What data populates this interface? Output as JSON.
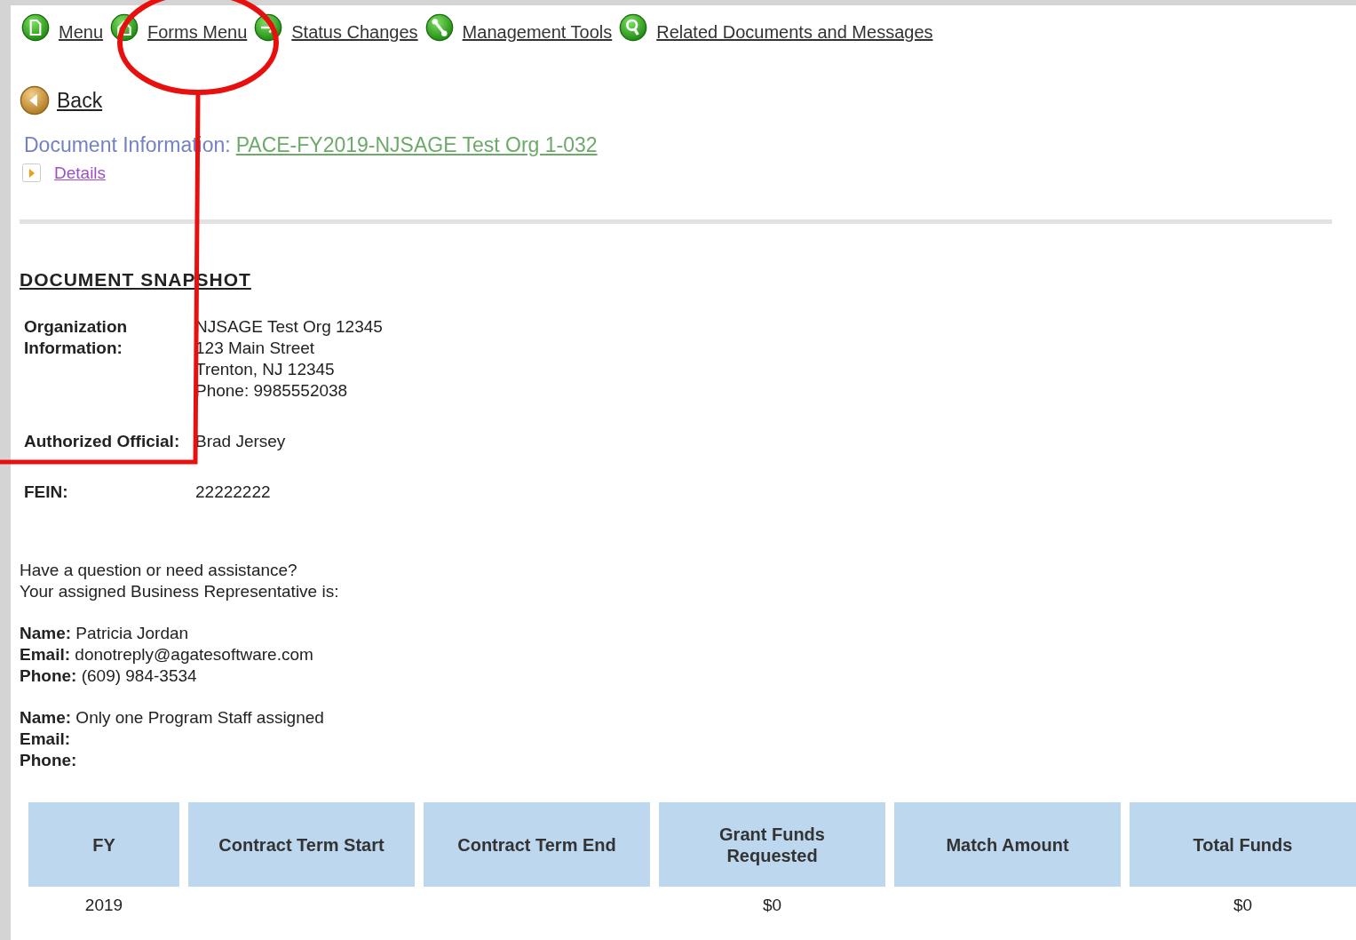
{
  "nav": [
    {
      "label": "Menu",
      "kind": "page"
    },
    {
      "label": "Forms Menu",
      "kind": "home"
    },
    {
      "label": "Status Changes",
      "kind": "arrow"
    },
    {
      "label": "Management Tools",
      "kind": "wrench"
    },
    {
      "label": "Related Documents and Messages",
      "kind": "search"
    }
  ],
  "back": {
    "label": "Back"
  },
  "document_info": {
    "label": "Document Information:",
    "link": "PACE-FY2019-NJSAGE Test Org 1-032"
  },
  "details": {
    "label": "Details"
  },
  "snapshot": {
    "title": "DOCUMENT SNAPSHOT",
    "fields": [
      {
        "label": "Organization Information:",
        "lines": [
          "NJSAGE Test Org 12345",
          "123 Main Street",
          "Trenton, NJ 12345",
          "Phone: 9985552038"
        ]
      },
      {
        "label": "Authorized Official:",
        "lines": [
          "Brad Jersey"
        ]
      },
      {
        "label": "FEIN:",
        "lines": [
          "22222222"
        ]
      }
    ]
  },
  "contact": {
    "intro": [
      "Have a question or need assistance?",
      "Your assigned Business Representative is:"
    ],
    "representatives": [
      [
        {
          "label": "Name:",
          "value": "Patricia Jordan"
        },
        {
          "label": "Email:",
          "value": "donotreply@agatesoftware.com"
        },
        {
          "label": "Phone:",
          "value": "(609) 984-3534"
        }
      ],
      [
        {
          "label": "Name:",
          "value": "Only one Program Staff assigned"
        },
        {
          "label": "Email:"
        },
        {
          "label": "Phone:"
        }
      ]
    ]
  },
  "table": {
    "columns": [
      "FY",
      "Contract Term Start",
      "Contract Term End",
      "Grant Funds Requested",
      "Match Amount",
      "Total Funds"
    ],
    "rows": [
      {
        "cells": [
          {
            "text": "2019"
          },
          {},
          {},
          {
            "text": "$0"
          },
          {},
          {
            "text": "$0"
          }
        ]
      }
    ]
  },
  "annotation": {
    "kind": "circle-callout"
  }
}
